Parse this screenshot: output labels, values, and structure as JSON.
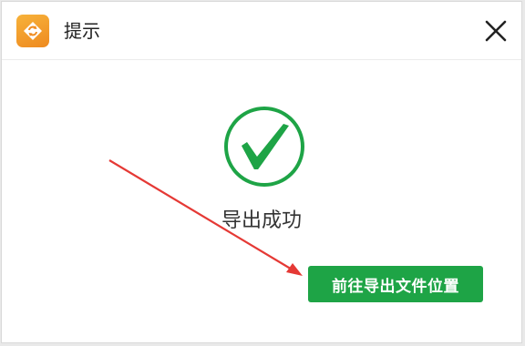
{
  "window": {
    "title": "提示",
    "app_icon": "app-logo-icon",
    "close_icon": "close-icon"
  },
  "content": {
    "status_icon": "check-circle-icon",
    "message": "导出成功",
    "open_location_label": "前往导出文件位置"
  },
  "colors": {
    "success_green": "#1ea446",
    "accent_orange": "#f39a27",
    "annotation_red": "#e53935"
  }
}
